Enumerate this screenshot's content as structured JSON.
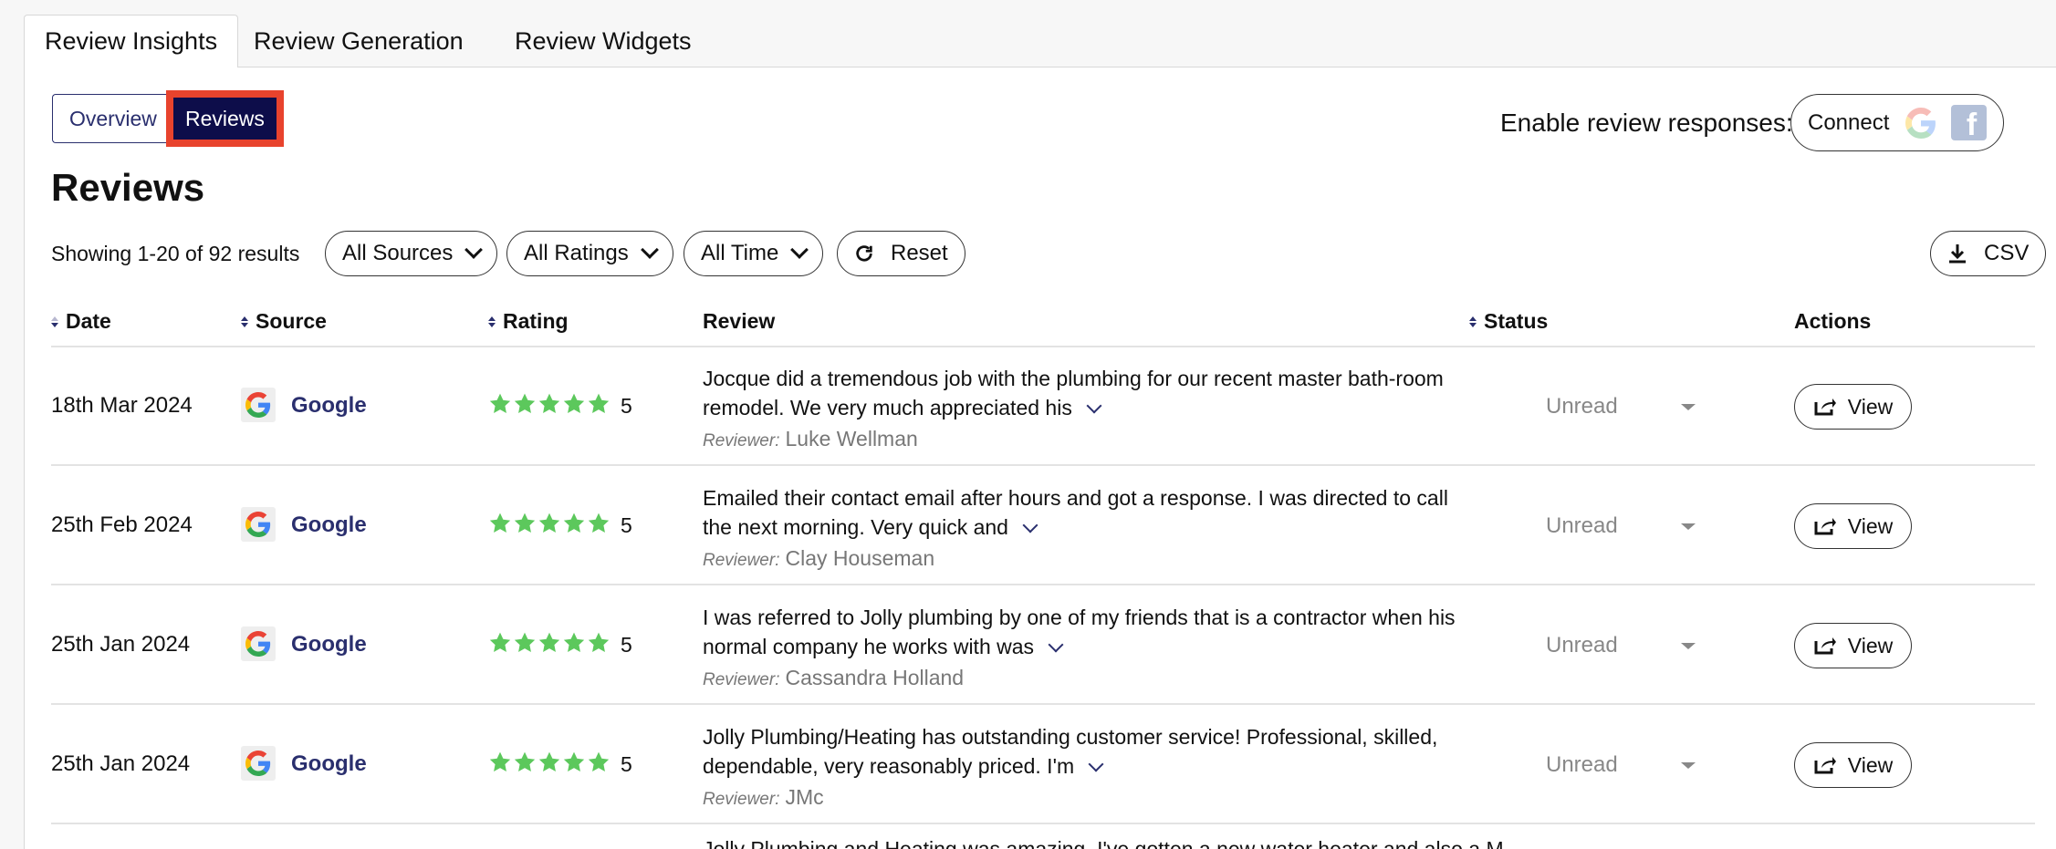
{
  "tabs": [
    {
      "label": "Review Insights",
      "active": true
    },
    {
      "label": "Review Generation",
      "active": false
    },
    {
      "label": "Review Widgets",
      "active": false
    }
  ],
  "segment": {
    "overview": "Overview",
    "reviews": "Reviews"
  },
  "enable_label": "Enable review responses:",
  "connect_label": "Connect",
  "heading": "Reviews",
  "showing": "Showing 1-20 of 92 results",
  "filters": {
    "sources": "All Sources",
    "ratings": "All Ratings",
    "time": "All Time",
    "reset": "Reset",
    "csv": "CSV"
  },
  "columns": {
    "date": "Date",
    "source": "Source",
    "rating": "Rating",
    "review": "Review",
    "status": "Status",
    "actions": "Actions"
  },
  "reviewer_label": "Reviewer:",
  "rows": [
    {
      "date": "18th Mar 2024",
      "source": "Google",
      "rating": "5",
      "text": "Jocque did a tremendous job with the plumbing for our recent master bath-room remodel. We very much appreciated his",
      "reviewer": "Luke Wellman",
      "status": "Unread",
      "action": "View"
    },
    {
      "date": "25th Feb 2024",
      "source": "Google",
      "rating": "5",
      "text": "Emailed their contact email after hours and got a response. I was directed to call the next morning. Very quick and",
      "reviewer": "Clay Houseman",
      "status": "Unread",
      "action": "View"
    },
    {
      "date": "25th Jan 2024",
      "source": "Google",
      "rating": "5",
      "text": "I was referred to Jolly plumbing by one of my friends that is a contractor when his normal company he works with was",
      "reviewer": "Cassandra Holland",
      "status": "Unread",
      "action": "View"
    },
    {
      "date": "25th Jan 2024",
      "source": "Google",
      "rating": "5",
      "text": "Jolly Plumbing/Heating has outstanding customer service! Professional, skilled, dependable, very reasonably priced. I'm",
      "reviewer": "JMc",
      "status": "Unread",
      "action": "View"
    }
  ],
  "partial_row_text": "Jolly Plumbing and Heating was amazing. I've gotten a new water heater and also a M..."
}
